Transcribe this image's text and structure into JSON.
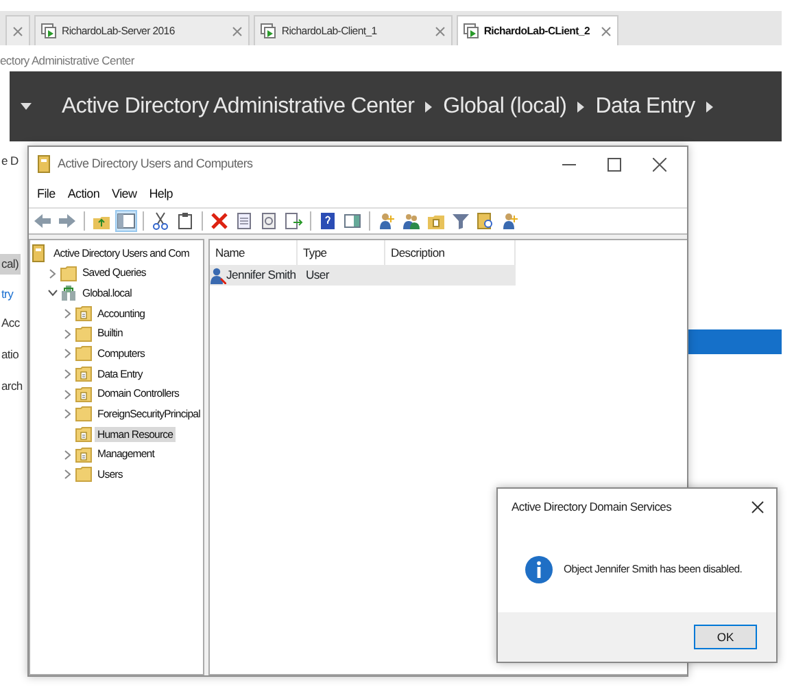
{
  "browser_tabs": [
    {
      "selected": false
    },
    {
      "label": "RichardoLab-Server 2016",
      "selected": false
    },
    {
      "label": "RichardoLab-Client_1",
      "selected": false
    },
    {
      "label": "RichardoLab-CLient_2",
      "selected": true
    }
  ],
  "page_title": "ectory Administrative Center",
  "adac": {
    "breadcrumbs": [
      "Active Directory Administrative Center",
      "Global (local)",
      "Data Entry"
    ],
    "side_items": [
      {
        "label": "e D",
        "selected": false
      },
      {
        "label": "cal)",
        "selected": true
      },
      {
        "label": "try",
        "selected": false,
        "kind": "link"
      },
      {
        "label": "Acc",
        "selected": false
      },
      {
        "label": "atio",
        "selected": false
      },
      {
        "label": "arch",
        "selected": false
      }
    ]
  },
  "aduc": {
    "title": "Active Directory Users and Computers",
    "menu": [
      "File",
      "Action",
      "View",
      "Help"
    ],
    "toolbar": [
      {
        "kind": "back",
        "pressed": false
      },
      {
        "kind": "forward",
        "pressed": false
      },
      {
        "kind": "sep"
      },
      {
        "kind": "up",
        "pressed": false
      },
      {
        "kind": "tree",
        "pressed": true
      },
      {
        "kind": "sep"
      },
      {
        "kind": "cut",
        "pressed": false
      },
      {
        "kind": "clipboard",
        "pressed": false
      },
      {
        "kind": "sep"
      },
      {
        "kind": "delete",
        "pressed": false
      },
      {
        "kind": "properties",
        "pressed": false
      },
      {
        "kind": "refresh",
        "pressed": false
      },
      {
        "kind": "export",
        "pressed": false
      },
      {
        "kind": "sep"
      },
      {
        "kind": "help",
        "pressed": false
      },
      {
        "kind": "view",
        "pressed": false
      },
      {
        "kind": "sep"
      },
      {
        "kind": "user",
        "pressed": false
      },
      {
        "kind": "group",
        "pressed": false
      },
      {
        "kind": "ou",
        "pressed": false
      },
      {
        "kind": "filter",
        "pressed": false
      },
      {
        "kind": "find",
        "pressed": false
      },
      {
        "kind": "user",
        "pressed": false
      }
    ],
    "tree": [
      {
        "label": "Active Directory Users and Com",
        "kind": "root",
        "selected": false,
        "children": [
          {
            "label": "Saved Queries",
            "kind": "container",
            "expanded": false,
            "selected": false
          },
          {
            "label": "Global.local",
            "kind": "domain",
            "expanded": true,
            "selected": false,
            "children": [
              {
                "label": "Accounting",
                "kind": "ou",
                "expanded": false,
                "selected": false
              },
              {
                "label": "Builtin",
                "kind": "container",
                "expanded": false,
                "selected": false
              },
              {
                "label": "Computers",
                "kind": "container",
                "expanded": false,
                "selected": false
              },
              {
                "label": "Data Entry",
                "kind": "ou",
                "expanded": false,
                "selected": false
              },
              {
                "label": "Domain Controllers",
                "kind": "ou",
                "expanded": false,
                "selected": false
              },
              {
                "label": "ForeignSecurityPrincipal",
                "kind": "container",
                "expanded": false,
                "selected": false
              },
              {
                "label": "Human Resource",
                "kind": "ou",
                "selected": true
              },
              {
                "label": "Management",
                "kind": "ou",
                "expanded": false,
                "selected": false
              },
              {
                "label": "Users",
                "kind": "container",
                "expanded": false,
                "selected": false
              }
            ]
          }
        ]
      }
    ],
    "columns": [
      "Name",
      "Type",
      "Description"
    ],
    "rows": [
      {
        "name": "Jennifer Smith",
        "type": "User",
        "selected": true
      }
    ]
  },
  "dialog": {
    "title": "Active Directory Domain Services",
    "message": "Object Jennifer Smith has been disabled.",
    "button": "OK"
  }
}
